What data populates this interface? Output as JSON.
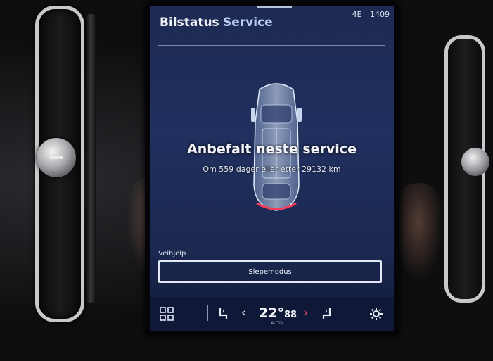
{
  "screen": {
    "tabs": [
      {
        "label": "Bilstatus",
        "active": true
      },
      {
        "label": "Service",
        "active": false
      }
    ],
    "status": {
      "signal": "4E",
      "time": "1409"
    },
    "service": {
      "title": "Anbefalt neste service",
      "subtitle": "Om 559 dager eller etter 29132 km"
    },
    "section_label": "Veihjelp",
    "mode_button": "Slepemodus",
    "climate": {
      "temp": "22°",
      "temp_decimal": "88",
      "temp_sub": "AUTO"
    }
  },
  "icons": [
    "grid-icon",
    "seat-heat-left-icon",
    "chevron-left-icon",
    "chevron-right-icon",
    "seat-heat-right-icon",
    "fan-settings-icon"
  ],
  "colors": {
    "screen_bg": "#20305f",
    "accent_tab": "#b9d0f6",
    "chevron_right": "#ff4d6d"
  }
}
